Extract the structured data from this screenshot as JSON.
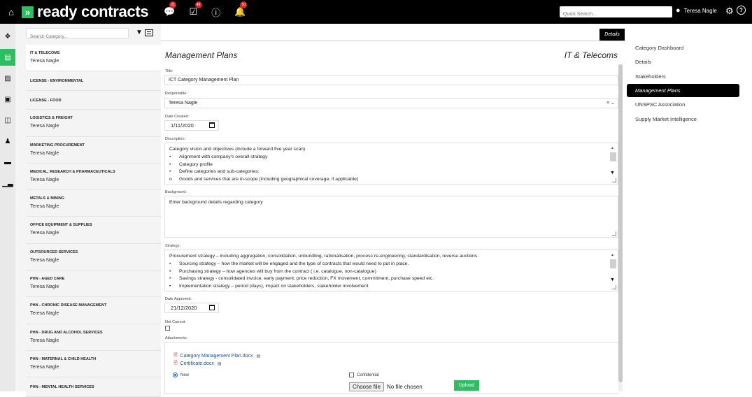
{
  "header": {
    "brand": "ready contracts",
    "brand_mark": "»",
    "notifications": [
      {
        "icon": "chat-icon",
        "count": "21"
      },
      {
        "icon": "tasks-icon",
        "count": "46"
      },
      {
        "icon": "info-icon",
        "count": ""
      },
      {
        "icon": "bell-icon",
        "count": "10"
      }
    ],
    "search_placeholder": "Quick Search...",
    "user_name": "Teresa Nagle"
  },
  "category_pane": {
    "search_placeholder": "Search Category...",
    "items": [
      {
        "name": "IT & TELECOMS",
        "owner": "Teresa Nagle",
        "selected": true
      },
      {
        "name": "LICENSE - ENVIRONMENTAL",
        "owner": ""
      },
      {
        "name": "LICENSE - FOOD",
        "owner": ""
      },
      {
        "name": "LOGISTICS & FREIGHT",
        "owner": "Teresa Nagle"
      },
      {
        "name": "MARKETING PROCUREMENT",
        "owner": "Teresa Nagle"
      },
      {
        "name": "MEDICAL, RESEARCH & PHARMACEUTICALS",
        "owner": "Teresa Nagle"
      },
      {
        "name": "METALS & MINING",
        "owner": "Teresa Nagle"
      },
      {
        "name": "OFFICE EQUIPMENT & SUPPLIES",
        "owner": "Teresa Nagle"
      },
      {
        "name": "OUTSOURCED SERVICES",
        "owner": "Teresa Nagle"
      },
      {
        "name": "PHN - AGED CARE",
        "owner": "Teresa Nagle"
      },
      {
        "name": "PHN - CHRONIC DISEASE MANAGEMENT",
        "owner": "Teresa Nagle"
      },
      {
        "name": "PHN - DRUG AND ALCOHOL SERVICES",
        "owner": "Teresa Nagle"
      },
      {
        "name": "PHN - MATERNAL & CHILD HEALTH",
        "owner": "Teresa Nagle"
      },
      {
        "name": "PHN - MENTAL HEALTH SERVICES",
        "owner": ""
      }
    ]
  },
  "main": {
    "details_tab": "Details",
    "page_title": "Management Plans",
    "category_title": "IT & Telecoms",
    "title_label": "Title:",
    "title_value": "ICT Category Management Plan",
    "responsible_label": "Responsible:",
    "responsible_value": "Teresa Nagle",
    "clear_glyph": "× ⌄",
    "date_created_label": "Date Created:",
    "date_created_value": "1/11/2020",
    "description_label": "Description:",
    "description_lines": [
      {
        "bullet": "",
        "text": "Category vision and objectives (include a forward five year scan)"
      },
      {
        "bullet": "•",
        "text": "Alignment with company's overall strategy"
      },
      {
        "bullet": "•",
        "text": "Category profile"
      },
      {
        "bullet": "•",
        "text": "Define categories and sub-categories:"
      },
      {
        "bullet": "o",
        "text": "Goods and services that are in-scope (including geographical coverage, if applicable)"
      }
    ],
    "background_label": "Background:",
    "background_value": "Enter background details regarding category",
    "strategy_label": "Strategy:",
    "strategy_lines": [
      {
        "bullet": "",
        "text": "Procurement strategy – including aggregation, consolidation, unbundling, rationalisation, process re-engineering, standardisation, reverse auctions."
      },
      {
        "bullet": "•",
        "text": "Sourcing strategy – how the market will be engaged and the type of contracts that would need to put in place."
      },
      {
        "bullet": "•",
        "text": "Purchasing strategy – how agencies will buy from the contract ( i.e. catalogue, non-catalogue)"
      },
      {
        "bullet": "•",
        "text": "Savings strategy - consolidated invoice, early payment, price reduction, FX movement, commitment, purchase speed etc."
      },
      {
        "bullet": "•",
        "text": "Implementation strategy – period (days), impact on stakeholders,  stakeholder involvement"
      }
    ],
    "date_approved_label": "Date Approved:",
    "date_approved_value": "21/12/2020",
    "not_current_label": "Not Current:",
    "attachments_label": "Attachments:",
    "attachments": [
      "Category Management Plan.docx",
      "Certificate.docx"
    ],
    "new_label": "New",
    "confidential_label": "Confidential",
    "choose_file_label": "Choose file",
    "no_file_label": "No file chosen",
    "upload_label": "Upload"
  },
  "right_nav": {
    "items": [
      {
        "label": "Category Dashboard",
        "active": false
      },
      {
        "label": "Details",
        "active": false
      },
      {
        "label": "Stakeholders",
        "active": false
      },
      {
        "label": "Management Plans",
        "active": true
      },
      {
        "label": "UNSPSC Association",
        "active": false
      },
      {
        "label": "Supply Market Intelligence",
        "active": false
      }
    ]
  },
  "colors": {
    "accent": "#2dbe60",
    "badge": "#e0242c",
    "link": "#1b4fa0"
  }
}
